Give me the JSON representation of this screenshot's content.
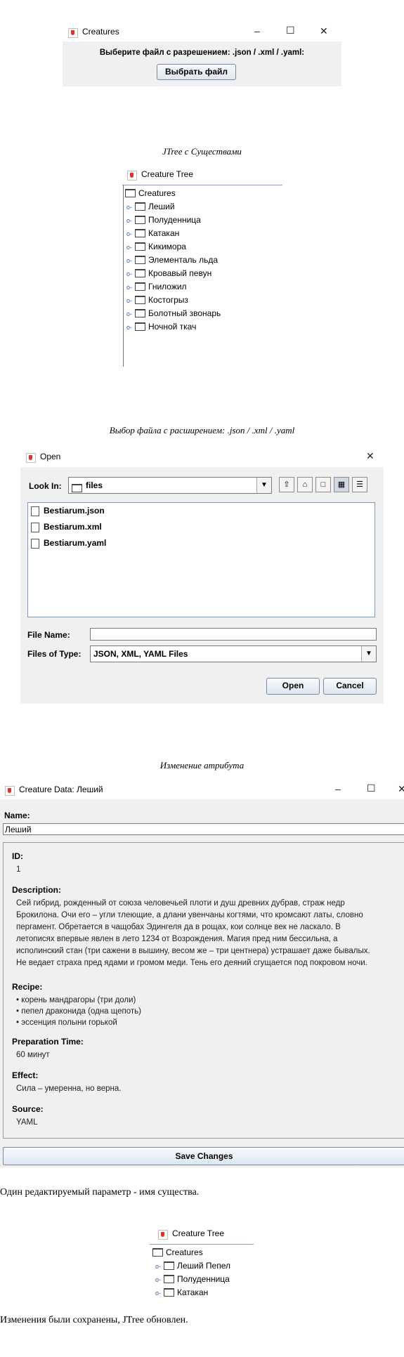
{
  "window1": {
    "title": "Creatures",
    "minimize": "–",
    "maximize": "☐",
    "close": "✕",
    "prompt": "Выберите файл с разрешением: .json / .xml / .yaml:",
    "choose_button": "Выбрать файл"
  },
  "caption_tree": "JTree с Существами",
  "tree1": {
    "title": "Creature Tree",
    "root": "Creatures",
    "items": [
      "Леший",
      "Полуденница",
      "Катакан",
      "Кикимора",
      "Элементаль льда",
      "Кровавый певун",
      "Гниложил",
      "Костогрыз",
      "Болотный звонарь",
      "Ночной ткач"
    ]
  },
  "caption_open": "Выбор файла с расширением: .json / .xml / .yaml",
  "open_dialog": {
    "title": "Open",
    "close": "✕",
    "look_in_label": "Look In:",
    "look_in_value": "files",
    "files": [
      "Bestiarum.json",
      "Bestiarum.xml",
      "Bestiarum.yaml"
    ],
    "file_name_label": "File Name:",
    "file_name_value": "",
    "files_of_type_label": "Files of Type:",
    "files_of_type_value": "JSON, XML, YAML Files",
    "open_button": "Open",
    "cancel_button": "Cancel"
  },
  "caption_edit": "Изменение атрибута",
  "data_window": {
    "title": "Creature Data: Леший",
    "minimize": "–",
    "maximize": "☐",
    "close": "✕",
    "name_label": "Name:",
    "name_value": "Леший",
    "id_label": "ID:",
    "id_value": "1",
    "description_label": "Description:",
    "description_lines": [
      "Сей гибрид, рожденный от союза человечьей плоти и душ древних дубрав, страж недр",
      "Брокилона. Очи его – угли тлеющие, а длани увенчаны когтями, что кромсают латы, словно",
      "пергамент. Обретается в чащобах Эдингеля да в рощах, кои солнце век не ласкало. В",
      "летописях впервые явлен в лето 1234 от Возрождения. Магия пред ним бессильна, а",
      "исполинский стан (три сажени в вышину, весом же – три центнера) устрашает даже бывалых.",
      "Не ведает страха пред ядами и громом меди. Тень его деяний сгущается под покровом ночи."
    ],
    "recipe_label": "Recipe:",
    "recipe_lines": [
      "• корень мандрагоры (три доли)",
      "• пепел драконида (одна щепоть)",
      "• эссенция полыни горькой"
    ],
    "prep_label": "Preparation Time:",
    "prep_value": "60 минут",
    "effect_label": "Effect:",
    "effect_value": "Сила – умеренна, но верна.",
    "source_label": "Source:",
    "source_value": "YAML",
    "save_button": "Save Changes"
  },
  "paragraph1": "Один редактируемый параметр - имя существа.",
  "tree2": {
    "title": "Creature Tree",
    "root": "Creatures",
    "items": [
      "Леший Пепел",
      "Полуденница",
      "Катакан"
    ]
  },
  "paragraph2": "Изменения были сохранены, JTree обновлен."
}
